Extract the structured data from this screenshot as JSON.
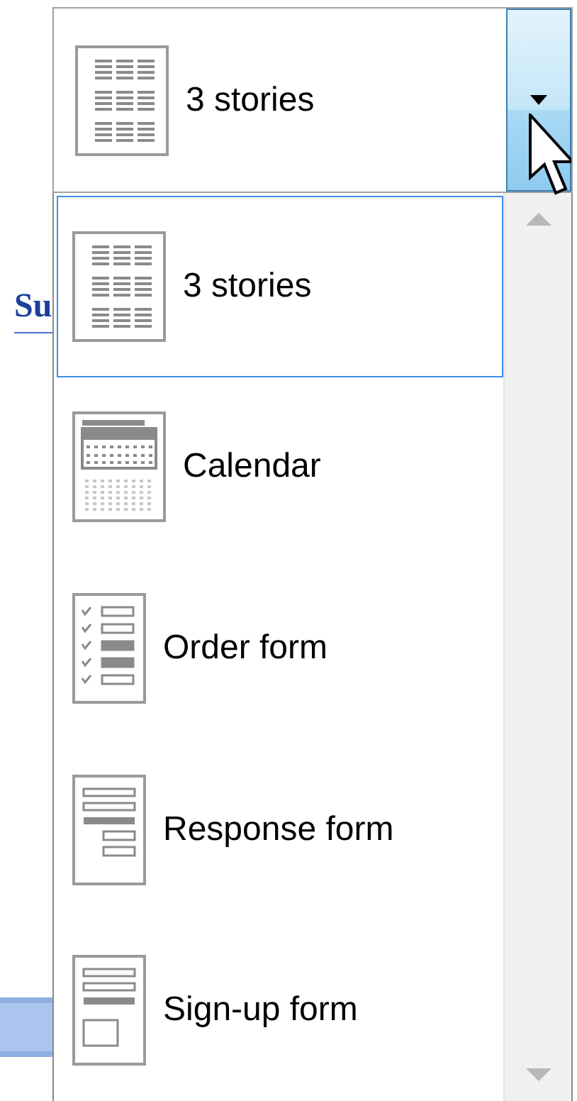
{
  "background": {
    "link_text": "Su"
  },
  "combo": {
    "value": "3 stories",
    "kind": "grid"
  },
  "items": [
    {
      "label": "3 stories",
      "kind": "grid",
      "selected": true
    },
    {
      "label": "Calendar",
      "kind": "calendar",
      "selected": false
    },
    {
      "label": "Order form",
      "kind": "checklist",
      "selected": false
    },
    {
      "label": "Response form",
      "kind": "response",
      "selected": false
    },
    {
      "label": "Sign-up form",
      "kind": "signup",
      "selected": false
    }
  ]
}
